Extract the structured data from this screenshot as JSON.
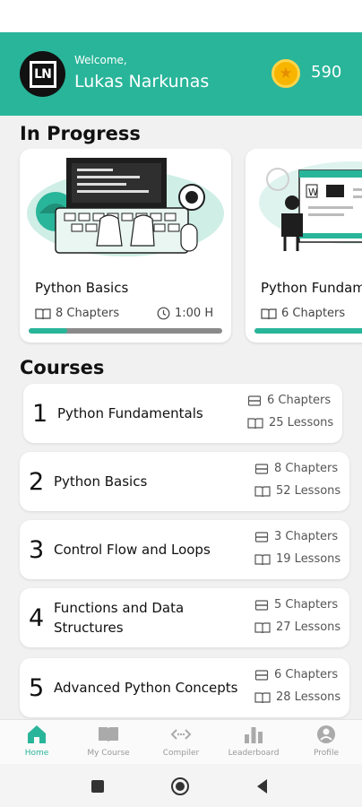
{
  "header": {
    "welcome": "Welcome,",
    "username": "Lukas Narkunas",
    "avatar_initials": "LN",
    "points": "590",
    "coin_icon": "star-coin-icon"
  },
  "in_progress": {
    "title": "In Progress",
    "cards": [
      {
        "title": "Python Basics",
        "chapters": "8 Chapters",
        "duration": "1:00 H",
        "progress": 0.2
      },
      {
        "title": "Python Fundamentals",
        "chapters": "6 Chapters",
        "duration": "",
        "progress": 0.6
      }
    ]
  },
  "courses": {
    "title": "Courses",
    "items": [
      {
        "num": "1",
        "name": "Python Fundamentals",
        "chapters": "6 Chapters",
        "lessons": "25 Lessons"
      },
      {
        "num": "2",
        "name": "Python Basics",
        "chapters": "8 Chapters",
        "lessons": "52 Lessons"
      },
      {
        "num": "3",
        "name": "Control Flow and Loops",
        "chapters": "3 Chapters",
        "lessons": "19 Lessons"
      },
      {
        "num": "4",
        "name": "Functions and Data Structures",
        "chapters": "5 Chapters",
        "lessons": "27 Lessons"
      },
      {
        "num": "5",
        "name": "Advanced Python Concepts",
        "chapters": "6 Chapters",
        "lessons": "28 Lessons"
      }
    ]
  },
  "nav": {
    "items": [
      {
        "label": "Home",
        "icon": "home-icon",
        "active": true
      },
      {
        "label": "My Course",
        "icon": "book-icon",
        "active": false
      },
      {
        "label": "Compiler",
        "icon": "code-icon",
        "active": false
      },
      {
        "label": "Leaderboard",
        "icon": "bar-chart-icon",
        "active": false
      },
      {
        "label": "Profile",
        "icon": "profile-icon",
        "active": false
      }
    ]
  },
  "colors": {
    "accent": "#29b59a",
    "coin": "#f7b500",
    "track": "#8a8a8a"
  }
}
